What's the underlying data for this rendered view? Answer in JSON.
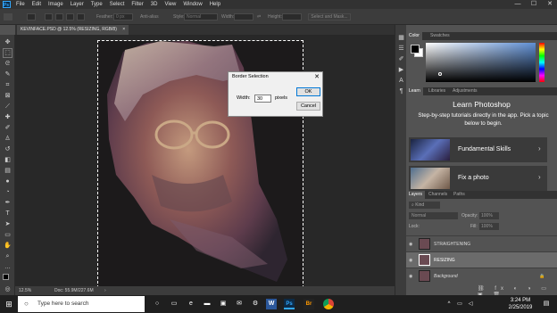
{
  "menu": {
    "items": [
      "File",
      "Edit",
      "Image",
      "Layer",
      "Type",
      "Select",
      "Filter",
      "3D",
      "View",
      "Window",
      "Help"
    ],
    "minimize": "—",
    "maximize": "☐",
    "close": "✕"
  },
  "options_bar": {
    "feather_label": "Feather:",
    "feather_value": "0 px",
    "antialias_label": "Anti-alias",
    "style_label": "Style:",
    "style_value": "Normal",
    "width_label": "Width:",
    "height_label": "Height:",
    "select_mask_label": "Select and Mask..."
  },
  "document": {
    "tab_title": "KEVINFACE.PSD @ 12.5% (RESIZING, RGB/8)",
    "tab_close": "×"
  },
  "status": {
    "zoom": "12.5%",
    "doc_info": "Doc: 55.9M/227.6M"
  },
  "dialog": {
    "title": "Border Selection",
    "close": "✕",
    "width_label": "Width:",
    "width_value": "30",
    "unit": "pixels",
    "ok": "OK",
    "cancel": "Cancel"
  },
  "color_panel": {
    "tabs": [
      "Color",
      "Swatches"
    ]
  },
  "learn_panel": {
    "tabs": [
      "Learn",
      "Libraries",
      "Adjustments"
    ],
    "heading": "Learn Photoshop",
    "description": "Step-by-step tutorials directly in the app. Pick a topic below to begin.",
    "topics": [
      {
        "label": "Fundamental Skills"
      },
      {
        "label": "Fix a photo"
      }
    ]
  },
  "layers_panel": {
    "tabs": [
      "Layers",
      "Channels",
      "Paths"
    ],
    "kind_label": "Kind",
    "blend_mode": "Normal",
    "opacity_label": "Opacity:",
    "opacity_value": "100%",
    "lock_label": "Lock:",
    "fill_label": "Fill:",
    "fill_value": "100%",
    "layers": [
      {
        "name": "STRAIGHTENING",
        "selected": false
      },
      {
        "name": "RESIZING",
        "selected": true
      },
      {
        "name": "Background",
        "selected": false
      }
    ]
  },
  "taskbar": {
    "search_placeholder": "Type here to search",
    "time": "3:24 PM",
    "date": "2/25/2019"
  },
  "colors": {
    "app_bg": "#535353",
    "menubar_bg": "#323232",
    "accent": "#31a8ff",
    "taskbar_bg": "#1f1f1f"
  }
}
